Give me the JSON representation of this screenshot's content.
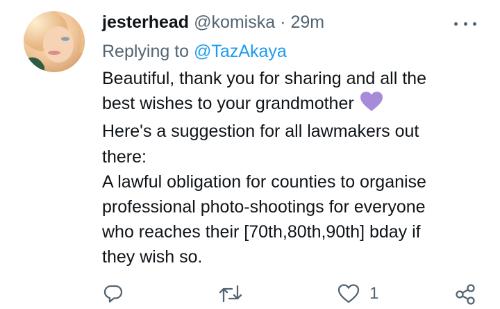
{
  "tweet": {
    "display_name": "jesterhead",
    "handle": "@komiska",
    "separator": "·",
    "time": "29m",
    "replying_prefix": "Replying to",
    "replying_to": "@TazAkaya",
    "lines": [
      "Beautiful, thank you for sharing and all the",
      "best wishes to your grandmother",
      "Here's a suggestion for all lawmakers out",
      "there:",
      "A lawful obligation for counties to organise",
      "professional photo-shootings for everyone",
      "who reaches their [70th,80th,90th] bday if",
      "they wish so."
    ],
    "emoji": "purple-heart",
    "like_count": "1"
  },
  "icons": {
    "more": "more-options-icon",
    "reply": "reply-icon",
    "retweet": "retweet-icon",
    "like": "like-icon",
    "share": "share-icon"
  },
  "colors": {
    "text": "#0f1419",
    "secondary": "#536471",
    "link": "#1d9bf0",
    "heart": "#a78bdb"
  }
}
